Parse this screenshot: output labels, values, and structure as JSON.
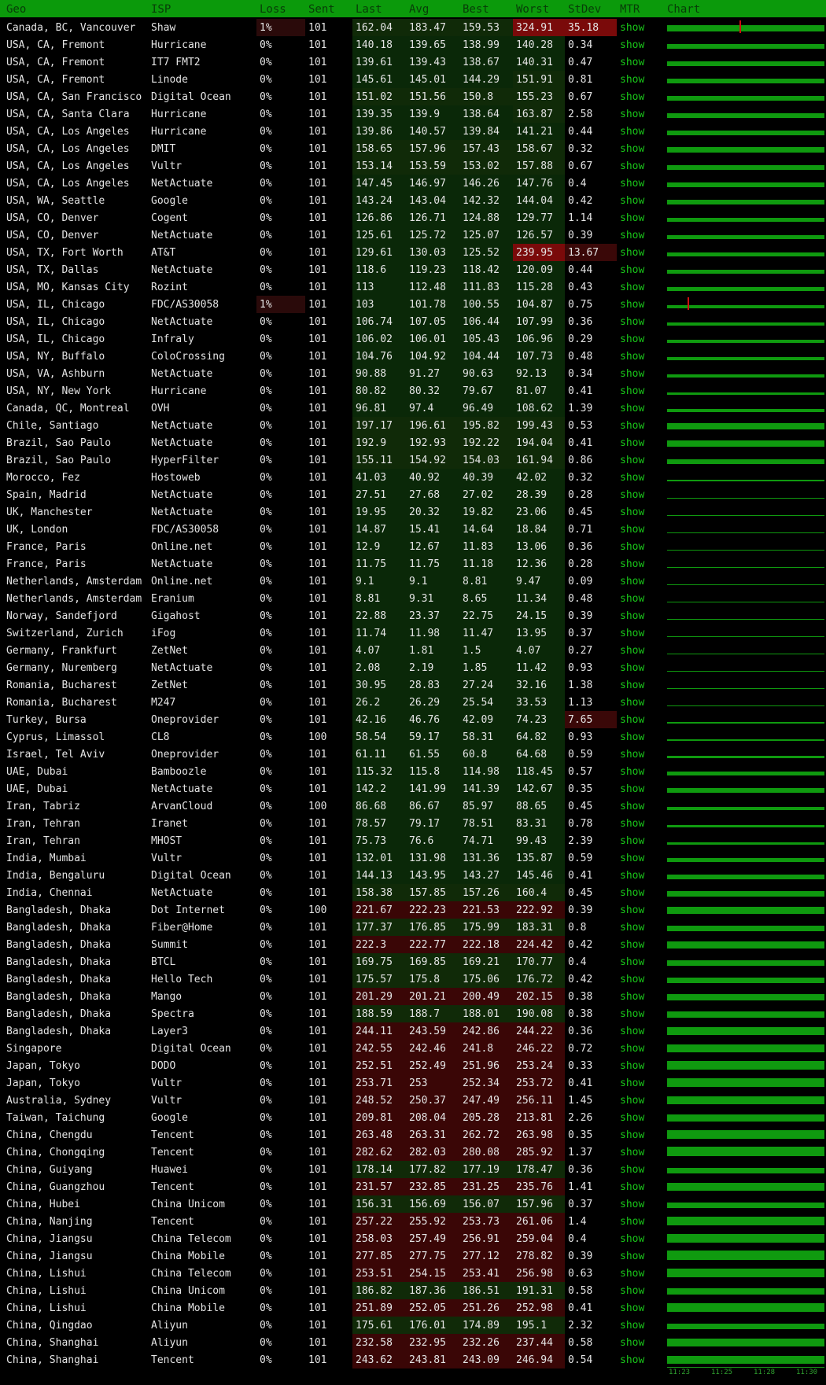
{
  "header": [
    "Geo",
    "ISP",
    "Loss",
    "Sent",
    "Last",
    "Avg",
    "Best",
    "Worst",
    "StDev",
    "MTR",
    "Chart"
  ],
  "rows": [
    [
      "Canada, BC, Vancouver",
      "Shaw",
      "1%",
      "101",
      "162.04",
      "183.47",
      "159.53",
      "324.91",
      "35.18",
      "show"
    ],
    [
      "USA, CA, Fremont",
      "Hurricane",
      "0%",
      "101",
      "140.18",
      "139.65",
      "138.99",
      "140.28",
      "0.34",
      "show"
    ],
    [
      "USA, CA, Fremont",
      "IT7 FMT2",
      "0%",
      "101",
      "139.61",
      "139.43",
      "138.67",
      "140.31",
      "0.47",
      "show"
    ],
    [
      "USA, CA, Fremont",
      "Linode",
      "0%",
      "101",
      "145.61",
      "145.01",
      "144.29",
      "151.91",
      "0.81",
      "show"
    ],
    [
      "USA, CA, San Francisco",
      "Digital Ocean",
      "0%",
      "101",
      "151.02",
      "151.56",
      "150.8",
      "155.23",
      "0.67",
      "show"
    ],
    [
      "USA, CA, Santa Clara",
      "Hurricane",
      "0%",
      "101",
      "139.35",
      "139.9",
      "138.64",
      "163.87",
      "2.58",
      "show"
    ],
    [
      "USA, CA, Los Angeles",
      "Hurricane",
      "0%",
      "101",
      "139.86",
      "140.57",
      "139.84",
      "141.21",
      "0.44",
      "show"
    ],
    [
      "USA, CA, Los Angeles",
      "DMIT",
      "0%",
      "101",
      "158.65",
      "157.96",
      "157.43",
      "158.67",
      "0.32",
      "show"
    ],
    [
      "USA, CA, Los Angeles",
      "Vultr",
      "0%",
      "101",
      "153.14",
      "153.59",
      "153.02",
      "157.88",
      "0.67",
      "show"
    ],
    [
      "USA, CA, Los Angeles",
      "NetActuate",
      "0%",
      "101",
      "147.45",
      "146.97",
      "146.26",
      "147.76",
      "0.4",
      "show"
    ],
    [
      "USA, WA, Seattle",
      "Google",
      "0%",
      "101",
      "143.24",
      "143.04",
      "142.32",
      "144.04",
      "0.42",
      "show"
    ],
    [
      "USA, CO, Denver",
      "Cogent",
      "0%",
      "101",
      "126.86",
      "126.71",
      "124.88",
      "129.77",
      "1.14",
      "show"
    ],
    [
      "USA, CO, Denver",
      "NetActuate",
      "0%",
      "101",
      "125.61",
      "125.72",
      "125.07",
      "126.57",
      "0.39",
      "show"
    ],
    [
      "USA, TX, Fort Worth",
      "AT&T",
      "0%",
      "101",
      "129.61",
      "130.03",
      "125.52",
      "239.95",
      "13.67",
      "show"
    ],
    [
      "USA, TX, Dallas",
      "NetActuate",
      "0%",
      "101",
      "118.6",
      "119.23",
      "118.42",
      "120.09",
      "0.44",
      "show"
    ],
    [
      "USA, MO, Kansas City",
      "Rozint",
      "0%",
      "101",
      "113",
      "112.48",
      "111.83",
      "115.28",
      "0.43",
      "show"
    ],
    [
      "USA, IL, Chicago",
      "FDC/AS30058",
      "1%",
      "101",
      "103",
      "101.78",
      "100.55",
      "104.87",
      "0.75",
      "show"
    ],
    [
      "USA, IL, Chicago",
      "NetActuate",
      "0%",
      "101",
      "106.74",
      "107.05",
      "106.44",
      "107.99",
      "0.36",
      "show"
    ],
    [
      "USA, IL, Chicago",
      "Infraly",
      "0%",
      "101",
      "106.02",
      "106.01",
      "105.43",
      "106.96",
      "0.29",
      "show"
    ],
    [
      "USA, NY, Buffalo",
      "ColoCrossing",
      "0%",
      "101",
      "104.76",
      "104.92",
      "104.44",
      "107.73",
      "0.48",
      "show"
    ],
    [
      "USA, VA, Ashburn",
      "NetActuate",
      "0%",
      "101",
      "90.88",
      "91.27",
      "90.63",
      "92.13",
      "0.34",
      "show"
    ],
    [
      "USA, NY, New York",
      "Hurricane",
      "0%",
      "101",
      "80.82",
      "80.32",
      "79.67",
      "81.07",
      "0.41",
      "show"
    ],
    [
      "Canada, QC, Montreal",
      "OVH",
      "0%",
      "101",
      "96.81",
      "97.4",
      "96.49",
      "108.62",
      "1.39",
      "show"
    ],
    [
      "Chile, Santiago",
      "NetActuate",
      "0%",
      "101",
      "197.17",
      "196.61",
      "195.82",
      "199.43",
      "0.53",
      "show"
    ],
    [
      "Brazil, Sao Paulo",
      "NetActuate",
      "0%",
      "101",
      "192.9",
      "192.93",
      "192.22",
      "194.04",
      "0.41",
      "show"
    ],
    [
      "Brazil, Sao Paulo",
      "HyperFilter",
      "0%",
      "101",
      "155.11",
      "154.92",
      "154.03",
      "161.94",
      "0.86",
      "show"
    ],
    [
      "Morocco, Fez",
      "Hostoweb",
      "0%",
      "101",
      "41.03",
      "40.92",
      "40.39",
      "42.02",
      "0.32",
      "show"
    ],
    [
      "Spain, Madrid",
      "NetActuate",
      "0%",
      "101",
      "27.51",
      "27.68",
      "27.02",
      "28.39",
      "0.28",
      "show"
    ],
    [
      "UK, Manchester",
      "NetActuate",
      "0%",
      "101",
      "19.95",
      "20.32",
      "19.82",
      "23.06",
      "0.45",
      "show"
    ],
    [
      "UK, London",
      "FDC/AS30058",
      "0%",
      "101",
      "14.87",
      "15.41",
      "14.64",
      "18.84",
      "0.71",
      "show"
    ],
    [
      "France, Paris",
      "Online.net",
      "0%",
      "101",
      "12.9",
      "12.67",
      "11.83",
      "13.06",
      "0.36",
      "show"
    ],
    [
      "France, Paris",
      "NetActuate",
      "0%",
      "101",
      "11.75",
      "11.75",
      "11.18",
      "12.36",
      "0.28",
      "show"
    ],
    [
      "Netherlands, Amsterdam",
      "Online.net",
      "0%",
      "101",
      "9.1",
      "9.1",
      "8.81",
      "9.47",
      "0.09",
      "show"
    ],
    [
      "Netherlands, Amsterdam",
      "Eranium",
      "0%",
      "101",
      "8.81",
      "9.31",
      "8.65",
      "11.34",
      "0.48",
      "show"
    ],
    [
      "Norway, Sandefjord",
      "Gigahost",
      "0%",
      "101",
      "22.88",
      "23.37",
      "22.75",
      "24.15",
      "0.39",
      "show"
    ],
    [
      "Switzerland, Zurich",
      "iFog",
      "0%",
      "101",
      "11.74",
      "11.98",
      "11.47",
      "13.95",
      "0.37",
      "show"
    ],
    [
      "Germany, Frankfurt",
      "ZetNet",
      "0%",
      "101",
      "4.07",
      "1.81",
      "1.5",
      "4.07",
      "0.27",
      "show"
    ],
    [
      "Germany, Nuremberg",
      "NetActuate",
      "0%",
      "101",
      "2.08",
      "2.19",
      "1.85",
      "11.42",
      "0.93",
      "show"
    ],
    [
      "Romania, Bucharest",
      "ZetNet",
      "0%",
      "101",
      "30.95",
      "28.83",
      "27.24",
      "32.16",
      "1.38",
      "show"
    ],
    [
      "Romania, Bucharest",
      "M247",
      "0%",
      "101",
      "26.2",
      "26.29",
      "25.54",
      "33.53",
      "1.13",
      "show"
    ],
    [
      "Turkey, Bursa",
      "Oneprovider",
      "0%",
      "101",
      "42.16",
      "46.76",
      "42.09",
      "74.23",
      "7.65",
      "show"
    ],
    [
      "Cyprus, Limassol",
      "CL8",
      "0%",
      "100",
      "58.54",
      "59.17",
      "58.31",
      "64.82",
      "0.93",
      "show"
    ],
    [
      "Israel, Tel Aviv",
      "Oneprovider",
      "0%",
      "101",
      "61.11",
      "61.55",
      "60.8",
      "64.68",
      "0.59",
      "show"
    ],
    [
      "UAE, Dubai",
      "Bamboozle",
      "0%",
      "101",
      "115.32",
      "115.8",
      "114.98",
      "118.45",
      "0.57",
      "show"
    ],
    [
      "UAE, Dubai",
      "NetActuate",
      "0%",
      "101",
      "142.2",
      "141.99",
      "141.39",
      "142.67",
      "0.35",
      "show"
    ],
    [
      "Iran, Tabriz",
      "ArvanCloud",
      "0%",
      "100",
      "86.68",
      "86.67",
      "85.97",
      "88.65",
      "0.45",
      "show"
    ],
    [
      "Iran, Tehran",
      "Iranet",
      "0%",
      "101",
      "78.57",
      "79.17",
      "78.51",
      "83.31",
      "0.78",
      "show"
    ],
    [
      "Iran, Tehran",
      "MHOST",
      "0%",
      "101",
      "75.73",
      "76.6",
      "74.71",
      "99.43",
      "2.39",
      "show"
    ],
    [
      "India, Mumbai",
      "Vultr",
      "0%",
      "101",
      "132.01",
      "131.98",
      "131.36",
      "135.87",
      "0.59",
      "show"
    ],
    [
      "India, Bengaluru",
      "Digital Ocean",
      "0%",
      "101",
      "144.13",
      "143.95",
      "143.27",
      "145.46",
      "0.41",
      "show"
    ],
    [
      "India, Chennai",
      "NetActuate",
      "0%",
      "101",
      "158.38",
      "157.85",
      "157.26",
      "160.4",
      "0.45",
      "show"
    ],
    [
      "Bangladesh, Dhaka",
      "Dot Internet",
      "0%",
      "100",
      "221.67",
      "222.23",
      "221.53",
      "222.92",
      "0.39",
      "show"
    ],
    [
      "Bangladesh, Dhaka",
      "Fiber@Home",
      "0%",
      "101",
      "177.37",
      "176.85",
      "175.99",
      "183.31",
      "0.8",
      "show"
    ],
    [
      "Bangladesh, Dhaka",
      "Summit",
      "0%",
      "101",
      "222.3",
      "222.77",
      "222.18",
      "224.42",
      "0.42",
      "show"
    ],
    [
      "Bangladesh, Dhaka",
      "BTCL",
      "0%",
      "101",
      "169.75",
      "169.85",
      "169.21",
      "170.77",
      "0.4",
      "show"
    ],
    [
      "Bangladesh, Dhaka",
      "Hello Tech",
      "0%",
      "101",
      "175.57",
      "175.8",
      "175.06",
      "176.72",
      "0.42",
      "show"
    ],
    [
      "Bangladesh, Dhaka",
      "Mango",
      "0%",
      "101",
      "201.29",
      "201.21",
      "200.49",
      "202.15",
      "0.38",
      "show"
    ],
    [
      "Bangladesh, Dhaka",
      "Spectra",
      "0%",
      "101",
      "188.59",
      "188.7",
      "188.01",
      "190.08",
      "0.38",
      "show"
    ],
    [
      "Bangladesh, Dhaka",
      "Layer3",
      "0%",
      "101",
      "244.11",
      "243.59",
      "242.86",
      "244.22",
      "0.36",
      "show"
    ],
    [
      "Singapore",
      "Digital Ocean",
      "0%",
      "101",
      "242.55",
      "242.46",
      "241.8",
      "246.22",
      "0.72",
      "show"
    ],
    [
      "Japan, Tokyo",
      "DODO",
      "0%",
      "101",
      "252.51",
      "252.49",
      "251.96",
      "253.24",
      "0.33",
      "show"
    ],
    [
      "Japan, Tokyo",
      "Vultr",
      "0%",
      "101",
      "253.71",
      "253",
      "252.34",
      "253.72",
      "0.41",
      "show"
    ],
    [
      "Australia, Sydney",
      "Vultr",
      "0%",
      "101",
      "248.52",
      "250.37",
      "247.49",
      "256.11",
      "1.45",
      "show"
    ],
    [
      "Taiwan, Taichung",
      "Google",
      "0%",
      "101",
      "209.81",
      "208.04",
      "205.28",
      "213.81",
      "2.26",
      "show"
    ],
    [
      "China, Chengdu",
      "Tencent",
      "0%",
      "101",
      "263.48",
      "263.31",
      "262.72",
      "263.98",
      "0.35",
      "show"
    ],
    [
      "China, Chongqing",
      "Tencent",
      "0%",
      "101",
      "282.62",
      "282.03",
      "280.08",
      "285.92",
      "1.37",
      "show"
    ],
    [
      "China, Guiyang",
      "Huawei",
      "0%",
      "101",
      "178.14",
      "177.82",
      "177.19",
      "178.47",
      "0.36",
      "show"
    ],
    [
      "China, Guangzhou",
      "Tencent",
      "0%",
      "101",
      "231.57",
      "232.85",
      "231.25",
      "235.76",
      "1.41",
      "show"
    ],
    [
      "China, Hubei",
      "China Unicom",
      "0%",
      "101",
      "156.31",
      "156.69",
      "156.07",
      "157.96",
      "0.37",
      "show"
    ],
    [
      "China, Nanjing",
      "Tencent",
      "0%",
      "101",
      "257.22",
      "255.92",
      "253.73",
      "261.06",
      "1.4",
      "show"
    ],
    [
      "China, Jiangsu",
      "China Telecom",
      "0%",
      "101",
      "258.03",
      "257.49",
      "256.91",
      "259.04",
      "0.4",
      "show"
    ],
    [
      "China, Jiangsu",
      "China Mobile",
      "0%",
      "101",
      "277.85",
      "277.75",
      "277.12",
      "278.82",
      "0.39",
      "show"
    ],
    [
      "China, Lishui",
      "China Telecom",
      "0%",
      "101",
      "253.51",
      "254.15",
      "253.41",
      "256.98",
      "0.63",
      "show"
    ],
    [
      "China, Lishui",
      "China Unicom",
      "0%",
      "101",
      "186.82",
      "187.36",
      "186.51",
      "191.31",
      "0.58",
      "show"
    ],
    [
      "China, Lishui",
      "China Mobile",
      "0%",
      "101",
      "251.89",
      "252.05",
      "251.26",
      "252.98",
      "0.41",
      "show"
    ],
    [
      "China, Qingdao",
      "Aliyun",
      "0%",
      "101",
      "175.61",
      "176.01",
      "174.89",
      "195.1",
      "2.32",
      "show"
    ],
    [
      "China, Shanghai",
      "Aliyun",
      "0%",
      "101",
      "232.58",
      "232.95",
      "232.26",
      "237.44",
      "0.58",
      "show"
    ],
    [
      "China, Shanghai",
      "Tencent",
      "0%",
      "101",
      "243.62",
      "243.81",
      "243.09",
      "246.94",
      "0.54",
      "show"
    ]
  ],
  "chart_axis_ticks": [
    "11:23",
    "11:25",
    "11:28",
    "11:30"
  ],
  "colors": {
    "header_bg": "#0b9a0b",
    "header_text": "#083d08",
    "mtr_link": "#19c619",
    "chart_bar": "#0f9a0f",
    "spike": "#d01010"
  }
}
